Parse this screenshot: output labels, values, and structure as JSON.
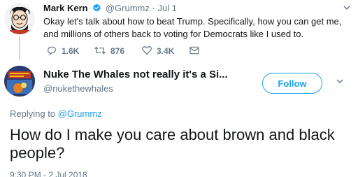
{
  "tweet1": {
    "author_name": "Mark Kern",
    "handle": "@Grummz",
    "separator": "·",
    "date": "Jul 1",
    "text": "Okay let's talk about how to beat Trump. Specifically, how you can get me, and millions of others back to voting for Democrats like I used to.",
    "reply_count": "1.6K",
    "retweet_count": "876",
    "like_count": "3.4K"
  },
  "tweet2": {
    "author_name": "Nuke The Whales not really it's a Si...",
    "handle": "@nukethewhales",
    "follow_label": "Follow",
    "replying_prefix": "Replying to",
    "replying_to": "@Grummz",
    "text": "How do I make you care about brown and black people?",
    "timestamp": "9:30 PM - 2 Jul 2018"
  },
  "colors": {
    "accent": "#1da1f2",
    "secondary_text": "#657786",
    "primary_text": "#14171a"
  },
  "icons": [
    "reply-icon",
    "retweet-icon",
    "like-icon",
    "direct-message-icon",
    "verified-badge-icon",
    "chevron-down-icon"
  ]
}
